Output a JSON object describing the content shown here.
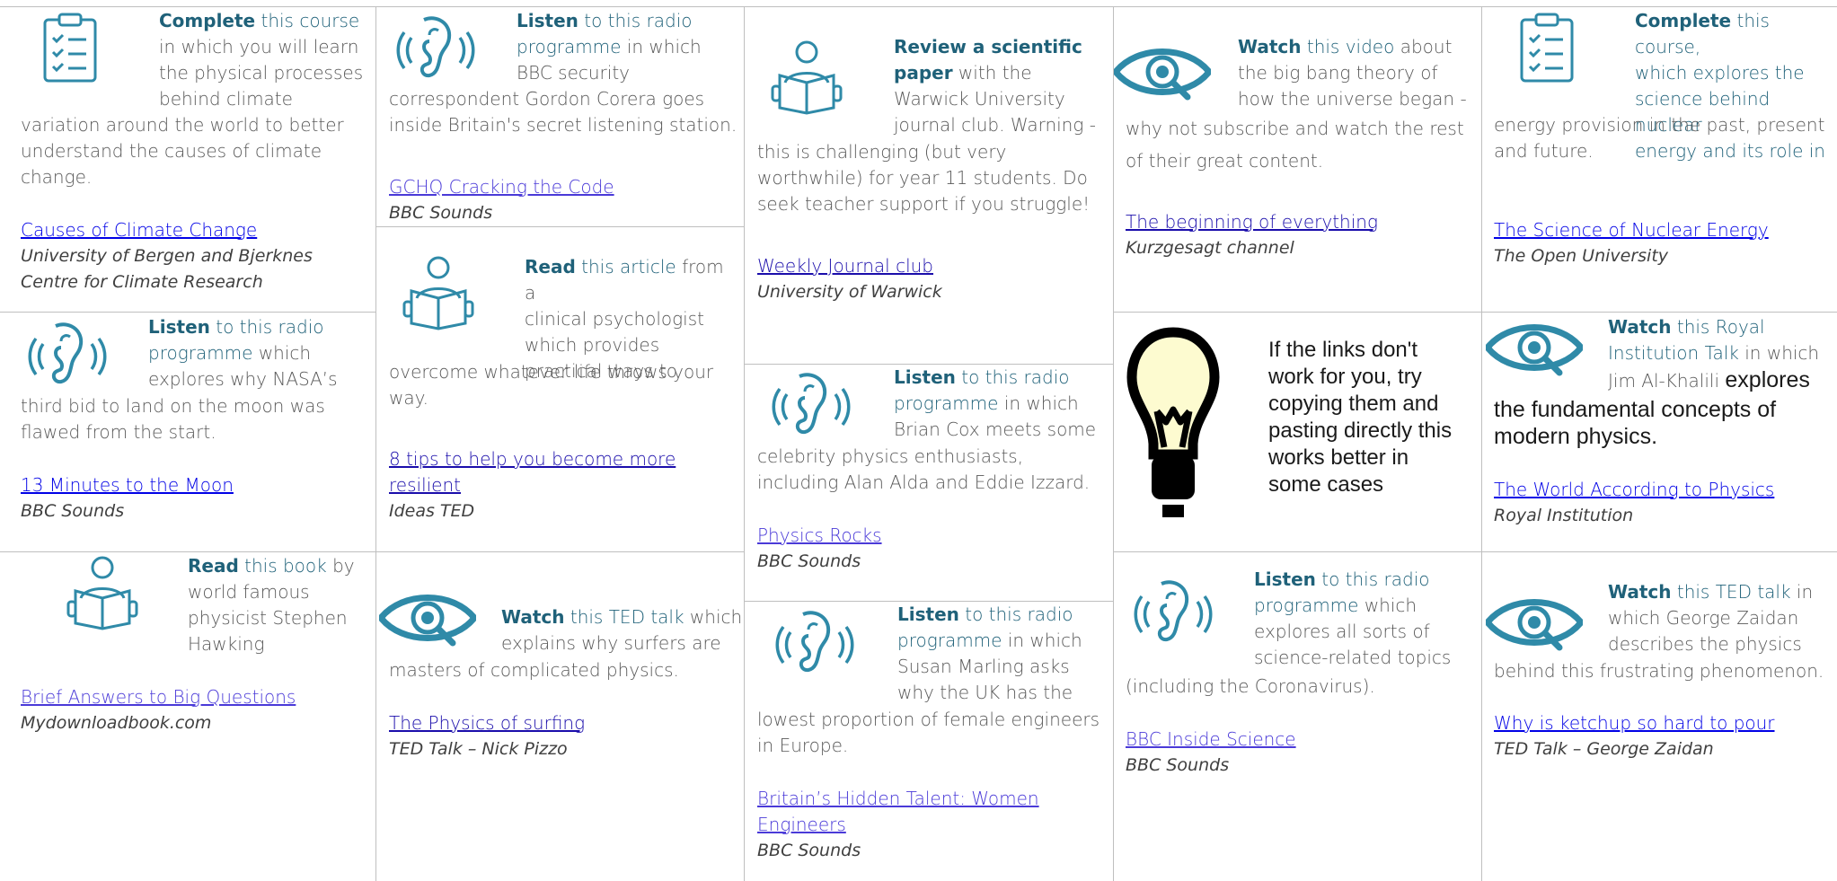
{
  "colors": {
    "accent": "#1f6179",
    "link": "#0000e6",
    "icon": "#2f8aa8",
    "bulb": "#fdfbd0"
  },
  "cards": {
    "c1": {
      "verb": "Complete",
      "lead": " this course",
      "rest1": "in which you will learn",
      "rest2": "the physical processes",
      "rest3": "behind climate",
      "flow": "variation around the world to better understand the causes of climate change.",
      "link": "Causes of Climate Change",
      "source": "University of Bergen and Bjerknes Centre for Climate Research",
      "icon": "clipboard-icon"
    },
    "c2": {
      "verb": "Listen",
      "lead": " to this radio",
      "lead2": "programme",
      "rest1": " in which",
      "rest2": "explores why NASA’s",
      "flow": "third bid to land on the moon was flawed from the start.",
      "mid": " which",
      "link": "13 Minutes to the Moon",
      "source": "BBC Sounds",
      "icon": "ear-icon"
    },
    "c3": {
      "verb": "Read",
      "lead": " this book",
      "rest": " by",
      "l2": "world famous",
      "l3": "physicist Stephen",
      "l4": "Hawking",
      "link": "Brief Answers to Big Questions",
      "source": "Mydownloadbook.com",
      "icon": "reader-icon"
    },
    "c4": {
      "verb": "Listen",
      "lead": " to this radio",
      "lead2": "programme",
      "rest1": " in which",
      "rest2": "BBC security",
      "flow": "correspondent Gordon Corera goes inside Britain's secret listening station.",
      "link": "GCHQ Cracking the Code",
      "source": "BBC Sounds",
      "icon": "ear-icon"
    },
    "c5": {
      "verb": "Read",
      "lead": " this article",
      "rest1": " from a",
      "l2": "clinical psychologist",
      "l3": "which provides",
      "l4": "practical ways to",
      "flow": "overcome whatever life throws your way.",
      "link": "8 tips to help you become more resilient",
      "source": "Ideas TED",
      "icon": "reader-icon"
    },
    "c6": {
      "verb": "Watch",
      "lead": " this TED talk",
      "rest1": " which",
      "l2": "explains why surfers are",
      "flow": "masters of complicated physics.",
      "link": "The Physics of surfing",
      "source": "TED Talk – Nick Pizzo",
      "icon": "eye-icon"
    },
    "c7": {
      "verb": "Review a scientific",
      "verb2": "paper",
      "rest1": " with the",
      "l2": "Warwick University",
      "l3": "journal club. Warning -",
      "flow": "this is challenging (but very worthwhile) for year 11 students. Do seek teacher support if you struggle!",
      "link": " Weekly Journal club",
      "source": "University of Warwick",
      "icon": "reader-icon"
    },
    "c8": {
      "verb": "Listen",
      "lead": " to this radio",
      "lead2": "programme",
      "rest1": " in which",
      "l2": "Brian Cox meets some",
      "flow": "celebrity physics enthusiasts, including Alan Alda and Eddie Izzard.",
      "link": "Physics Rocks",
      "source": "BBC Sounds",
      "icon": "ear-icon"
    },
    "c9": {
      "verb": "Listen",
      "lead": " to this radio",
      "lead2": "programme",
      "rest1": " in which",
      "l2": "Susan Marling asks",
      "l3": "why the UK has the",
      "flow": "lowest proportion of female engineers in Europe.",
      "link": "Britain’s Hidden Talent: Women Engineers",
      "source": "BBC Sounds",
      "icon": "ear-icon"
    },
    "c10": {
      "verb": "Watch",
      "lead": " this video",
      "rest1": " about",
      "l2": "the big bang theory of",
      "l3": "how the universe began -",
      "flow": "why not subscribe and watch the rest of their great content.",
      "link": "The beginning of everything",
      "source": "Kurzgesagt channel",
      "icon": "eye-icon"
    },
    "c11": {
      "note": "If the links don't work for you, try copying them and pasting directly this works better in some cases",
      "icon": "lightbulb-icon"
    },
    "c12": {
      "verb": "Listen",
      "lead": " to this radio",
      "lead2": "programme",
      "rest1": " which",
      "l2": "explores all sorts of",
      "l3": "science-related topics",
      "flow": "(including the Coronavirus).",
      "link": "BBC Inside Science",
      "source": "BBC Sounds",
      "icon": "ear-icon"
    },
    "c13": {
      "verb": "Complete",
      "lead": " this course,",
      "l2": "which explores the",
      "l3": "science behind nuclear",
      "l4": "energy and its role in",
      "flow": "energy provision in the past, present and future.",
      "link": "The Science of Nuclear Energy",
      "source": "The Open University",
      "icon": "clipboard-icon"
    },
    "c14": {
      "verb": "Watch",
      "lead": " this Royal",
      "lead2": "Institution Talk",
      "rest1": "  in which",
      "l3": "Jim Al-Khalili ",
      "l3b": " explores",
      "flow": "the fundamental concepts of modern physics.",
      "link": "The World According to Physics",
      "source": " Royal Institution",
      "icon": "eye-icon"
    },
    "c15": {
      "verb": "Watch",
      "lead": " this TED talk",
      "rest1": " in",
      "l2": "which George Zaidan",
      "l3": "describes the physics",
      "flow": "behind this frustrating phenomenon.",
      "link": "Why is ketchup so hard to pour",
      "source": "TED Talk – George Zaidan",
      "icon": "eye-icon"
    }
  }
}
